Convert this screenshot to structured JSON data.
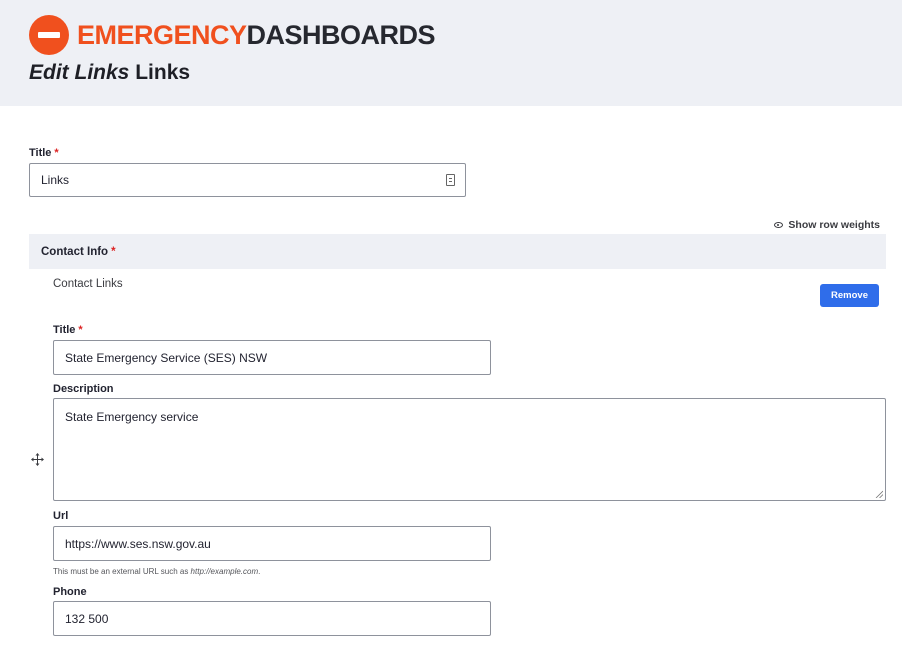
{
  "brand": {
    "name_part1": "EMERGENCY",
    "name_part2": "DASHBOARDS",
    "icon": "minus-circle-icon",
    "accent": "#f0501e"
  },
  "page": {
    "title_em": "Edit Links",
    "title_rest": "Links"
  },
  "form": {
    "title_label": "Title",
    "required_marker": "*",
    "title_value": "Links",
    "title_field_icon": "form-field-icon",
    "show_row_weights": "Show row weights",
    "show_row_weights_icon": "eye-icon"
  },
  "contact": {
    "header": "Contact Info",
    "subtitle": "Contact Links",
    "remove_label": "Remove",
    "drag_icon": "drag-move-icon",
    "title_label": "Title",
    "title_value": "State Emergency Service (SES) NSW",
    "description_label": "Description",
    "description_value": "State Emergency service",
    "url_label": "Url",
    "url_value": "https://www.ses.nsw.gov.au",
    "url_help_prefix": "This must be an external URL such as ",
    "url_help_example": "http://example.com",
    "url_help_suffix": ".",
    "phone_label": "Phone",
    "phone_value": "132 500"
  },
  "colors": {
    "header_bg": "#eef0f5",
    "button_blue": "#2f6dea",
    "required_red": "#dc2323"
  }
}
